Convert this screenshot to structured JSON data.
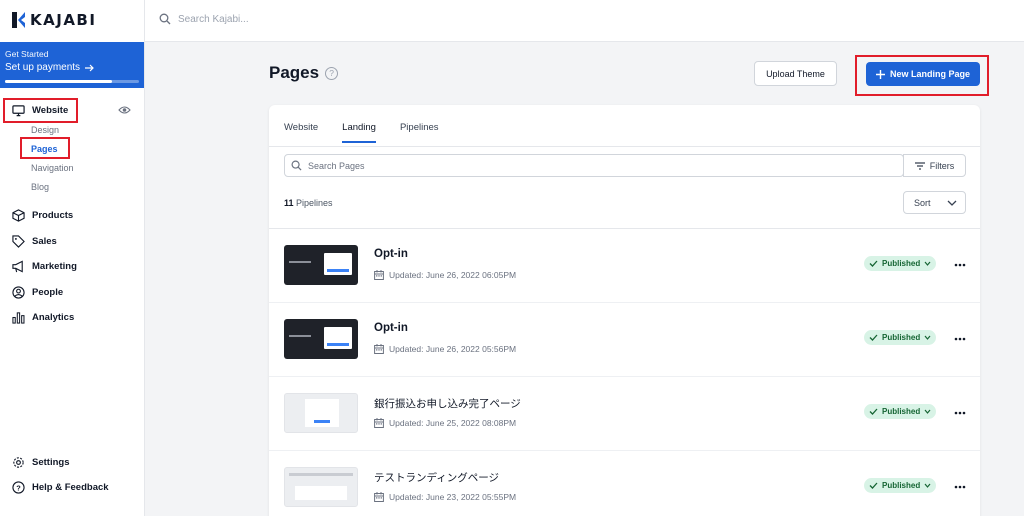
{
  "app": {
    "logo_text": "KAJABI"
  },
  "get_started": {
    "title": "Get Started",
    "link": "Set up payments",
    "progress": 0.8
  },
  "sidebar": {
    "items": [
      {
        "label": "Website",
        "icon": "monitor-icon"
      },
      {
        "label": "Products",
        "icon": "box-icon"
      },
      {
        "label": "Sales",
        "icon": "tag-icon"
      },
      {
        "label": "Marketing",
        "icon": "megaphone-icon"
      },
      {
        "label": "People",
        "icon": "user-circle-icon"
      },
      {
        "label": "Analytics",
        "icon": "bar-chart-icon"
      }
    ],
    "website_sub": [
      "Design",
      "Pages",
      "Navigation",
      "Blog"
    ],
    "bottom": [
      {
        "label": "Settings",
        "icon": "gear-icon"
      },
      {
        "label": "Help & Feedback",
        "icon": "help-icon"
      }
    ]
  },
  "topbar": {
    "search_placeholder": "Search Kajabi..."
  },
  "page": {
    "title": "Pages",
    "upload_theme": "Upload Theme",
    "new_landing_page": "New Landing Page",
    "tabs": [
      "Website",
      "Landing",
      "Pipelines"
    ],
    "active_tab": "Landing",
    "search_placeholder": "Search Pages",
    "filters_label": "Filters",
    "count_number": "11",
    "count_label": "Pipelines",
    "sort_label": "Sort"
  },
  "rows": [
    {
      "title": "Opt-in",
      "updated": "Updated: June 26, 2022 06:05PM",
      "status": "Published"
    },
    {
      "title": "Opt-in",
      "updated": "Updated: June 26, 2022 05:56PM",
      "status": "Published"
    },
    {
      "title": "銀行振込お申し込み完了ページ",
      "updated": "Updated: June 25, 2022 08:08PM",
      "status": "Published"
    },
    {
      "title": "テストランディングページ",
      "updated": "Updated: June 23, 2022 05:55PM",
      "status": "Published"
    }
  ],
  "colors": {
    "accent": "#1e63d6",
    "highlight": "#e11d2a",
    "published_bg": "#d8f3e6"
  }
}
